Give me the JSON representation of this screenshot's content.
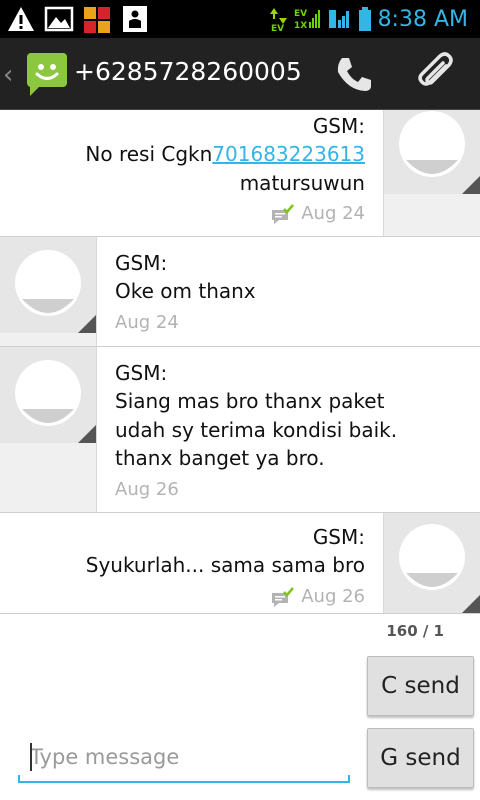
{
  "status_bar": {
    "time": "8:38 AM",
    "network_ev": "EV",
    "network_label": "EV",
    "icons": [
      "warning-icon",
      "image-icon",
      "app-icon",
      "profile-icon",
      "data-transfer-icon",
      "signal-ev-icon",
      "signal-3g-icon",
      "battery-icon"
    ]
  },
  "action_bar": {
    "title": "+6285728260005",
    "call_icon": "phone-icon",
    "attach_icon": "paperclip-icon"
  },
  "messages": [
    {
      "direction": "out",
      "sender": "GSM:",
      "text_prefix": "No resi Cgkn",
      "link": "701683223613",
      "text_suffix": "matursuwun",
      "date": "Aug 24",
      "delivered": true
    },
    {
      "direction": "in",
      "sender": "GSM:",
      "lines": [
        "Oke om thanx"
      ],
      "date": "Aug 24"
    },
    {
      "direction": "in",
      "sender": "GSM:",
      "lines": [
        "Siang mas bro thanx paket",
        "udah sy terima kondisi baik.",
        "thanx banget ya bro."
      ],
      "date": "Aug 26"
    },
    {
      "direction": "out",
      "sender": "GSM:",
      "lines": [
        "Syukurlah... sama sama bro"
      ],
      "date": "Aug 26",
      "delivered": true
    }
  ],
  "compose": {
    "counter": "160 / 1",
    "send_c_label": "C send",
    "send_g_label": "G send",
    "placeholder": "Type message",
    "value": ""
  },
  "colors": {
    "accent": "#33b5e5",
    "app_green": "#8dc63f"
  }
}
